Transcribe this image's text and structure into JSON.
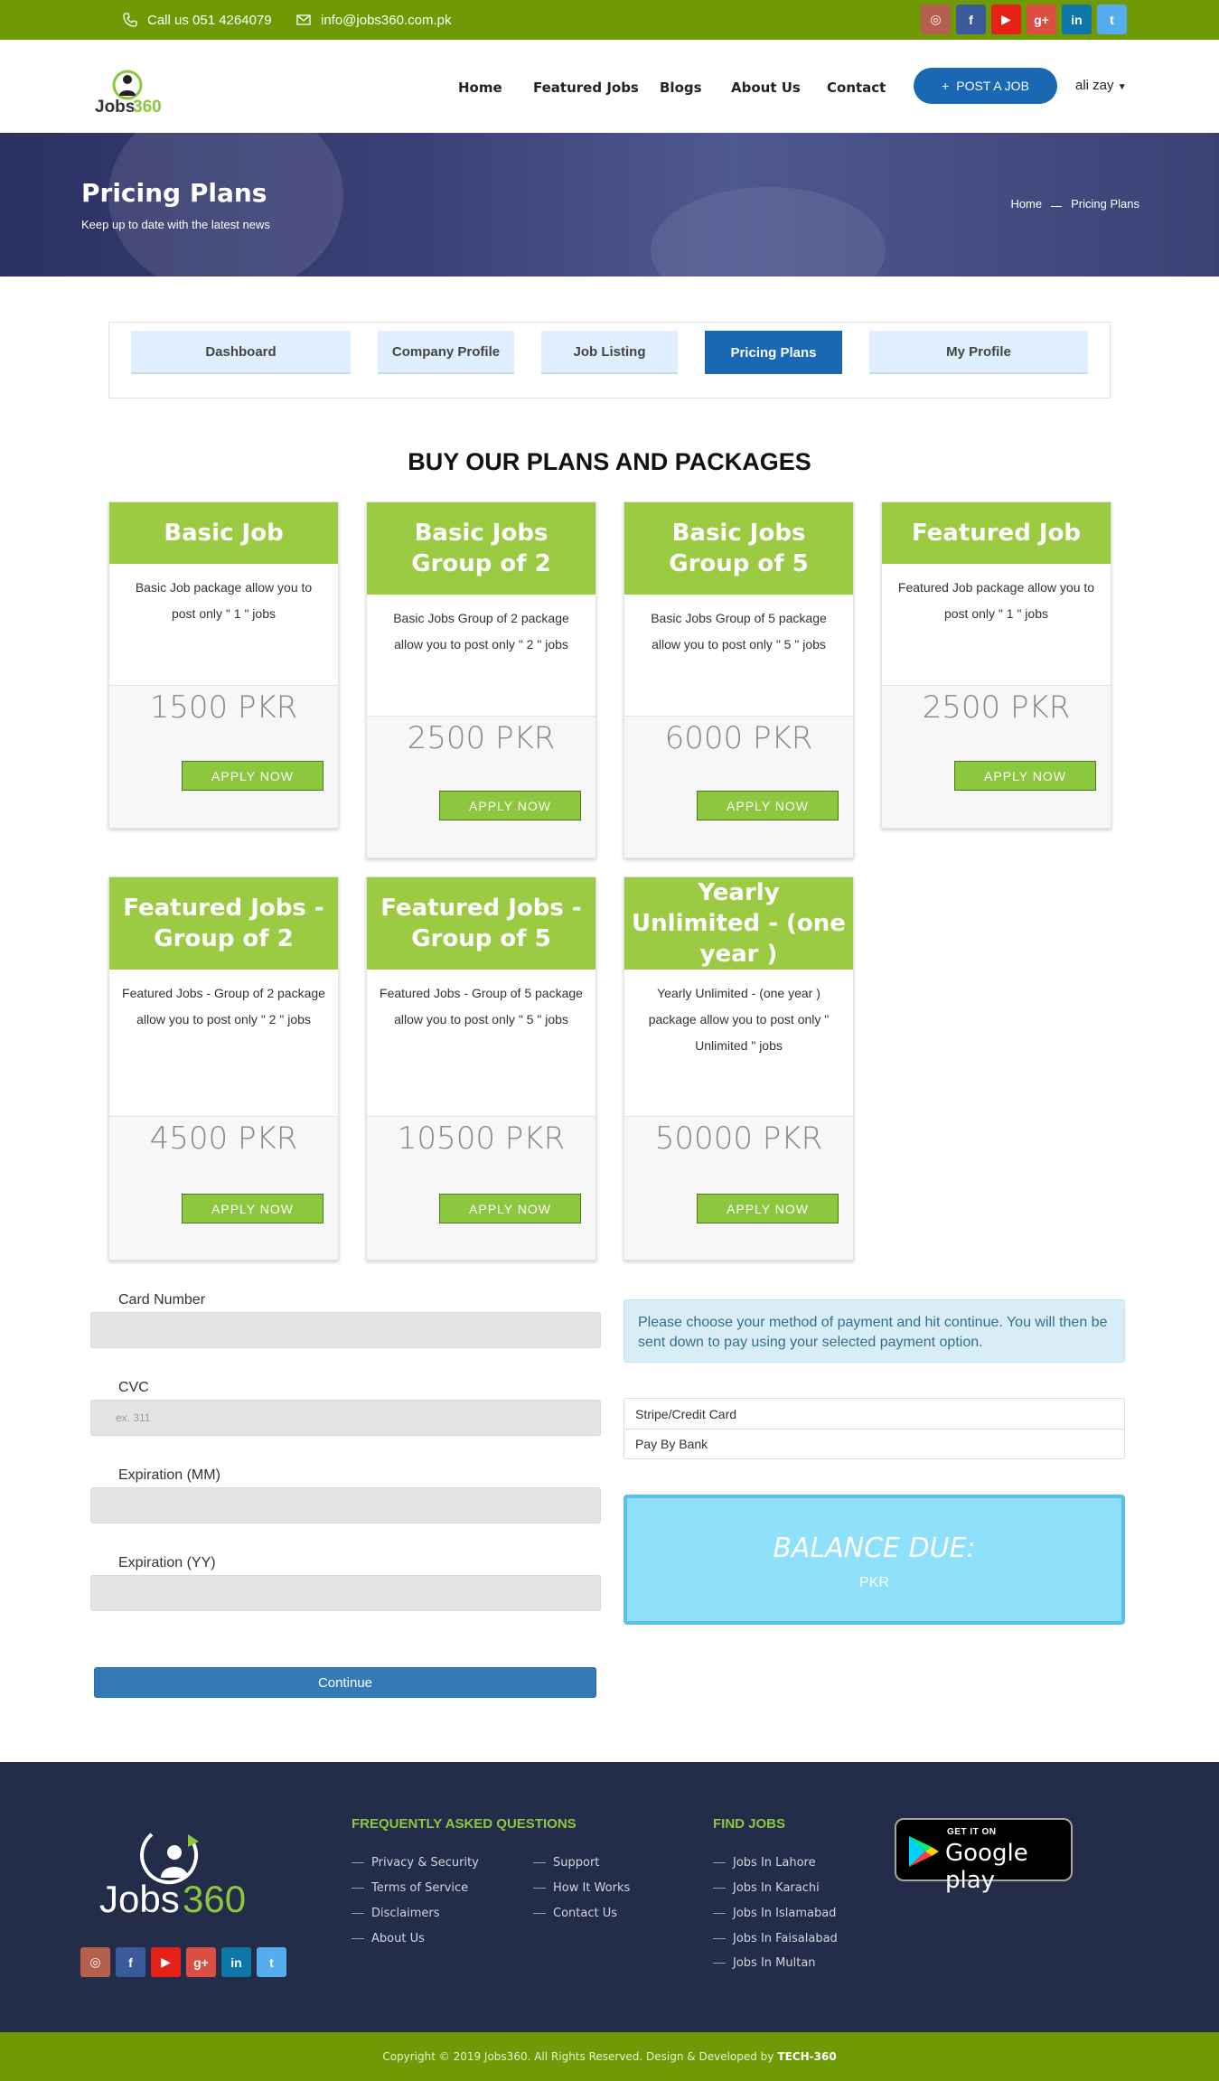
{
  "topbar": {
    "phone": "Call us 051 4264079",
    "email": "info@jobs360.com.pk",
    "social": [
      {
        "icon": "instagram-icon",
        "glyph": "◎",
        "color": "#b5604d"
      },
      {
        "icon": "facebook-icon",
        "glyph": "f",
        "color": "#3b5a9a"
      },
      {
        "icon": "youtube-icon",
        "glyph": "▶",
        "color": "#e62117"
      },
      {
        "icon": "google-plus-icon",
        "glyph": "g+",
        "color": "#dc4e41"
      },
      {
        "icon": "linkedin-icon",
        "glyph": "in",
        "color": "#0e76a8"
      },
      {
        "icon": "twitter-icon",
        "glyph": "t",
        "color": "#55acee"
      }
    ]
  },
  "header": {
    "logo_text": "Jobs360",
    "nav": [
      "Home",
      "Featured Jobs",
      "Blogs",
      "About Us",
      "Contact"
    ],
    "post_job": "POST A JOB",
    "user": "ali zay"
  },
  "hero": {
    "title": "Pricing Plans",
    "subtitle": "Keep up to date with the latest news",
    "breadcrumb_home": "Home",
    "breadcrumb_current": "Pricing Plans"
  },
  "tabs": [
    "Dashboard",
    "Company Profile",
    "Job Listing",
    "Pricing Plans",
    "My Profile"
  ],
  "section_title": "BUY OUR PLANS AND PACKAGES",
  "plans": [
    {
      "title": "Basic Job",
      "desc": "Basic Job package allow you to post only \" 1 \" jobs",
      "price": "1500 PKR",
      "button": "APPLY NOW"
    },
    {
      "title": "Basic Jobs Group of 2",
      "desc": "Basic Jobs Group of 2 package allow you to post only \" 2 \" jobs",
      "price": "2500 PKR",
      "button": "APPLY NOW"
    },
    {
      "title": "Basic Jobs Group of 5",
      "desc": "Basic Jobs Group of 5 package allow you to post only \" 5 \" jobs",
      "price": "6000 PKR",
      "button": "APPLY NOW"
    },
    {
      "title": "Featured Job",
      "desc": "Featured Job package allow you to post only \" 1 \" jobs",
      "price": "2500 PKR",
      "button": "APPLY NOW"
    },
    {
      "title": "Featured Jobs - Group of 2",
      "desc": "Featured Jobs - Group of 2 package allow you to post only \" 2 \" jobs",
      "price": "4500 PKR",
      "button": "APPLY NOW"
    },
    {
      "title": "Featured Jobs - Group of 5",
      "desc": "Featured Jobs - Group of 5 package allow you to post only \" 5 \" jobs",
      "price": "10500 PKR",
      "button": "APPLY NOW"
    },
    {
      "title": "Yearly Unlimited - (one year )",
      "desc": "Yearly Unlimited - (one year ) package allow you to post only \" Unlimited \" jobs",
      "price": "50000 PKR",
      "button": "APPLY NOW"
    }
  ],
  "form": {
    "card_number_label": "Card Number",
    "card_number_value": "",
    "cvc_label": "CVC",
    "cvc_placeholder": "ex. 311",
    "exp_mm_label": "Expiration (MM)",
    "exp_mm_value": "",
    "exp_yy_label": "Expiration (YY)",
    "exp_yy_value": "",
    "continue": "Continue"
  },
  "payment": {
    "info": "Please choose your method of payment and hit continue. You will then be sent down to pay using your selected payment option.",
    "options": [
      "Stripe/Credit Card",
      "Pay By Bank"
    ],
    "balance_label": "BALANCE DUE:",
    "balance_currency": "PKR"
  },
  "footer": {
    "logo_text": "Jobs360",
    "faq_title": "FREQUENTLY ASKED QUESTIONS",
    "faq_col1": [
      "Privacy & Security",
      "Terms of Service",
      "Disclaimers",
      "About Us"
    ],
    "faq_col2": [
      "Support",
      "How It Works",
      "Contact Us"
    ],
    "find_title": "FIND JOBS",
    "find_jobs": [
      "Jobs In Lahore",
      "Jobs In Karachi",
      "Jobs In Islamabad",
      "Jobs In Faisalabad",
      "Jobs In Multan"
    ],
    "gplay_top": "GET IT ON",
    "gplay_bottom": "Google play",
    "copyright": "Copyright © 2019 Jobs360. All Rights Reserved. Design & Developed by",
    "developer": "TECH-360"
  }
}
